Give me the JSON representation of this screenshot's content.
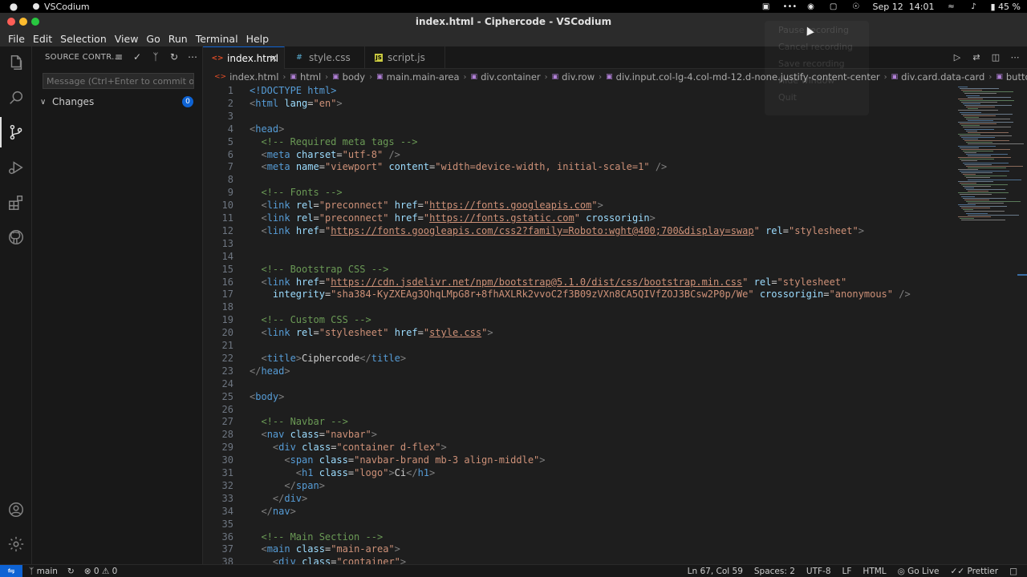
{
  "os": {
    "app_name": "VSCodium",
    "date": "Sep 12",
    "time": "14:01",
    "battery": "45 %"
  },
  "window": {
    "title": "index.html - Ciphercode - VSCodium"
  },
  "menu": [
    "File",
    "Edit",
    "Selection",
    "View",
    "Go",
    "Run",
    "Terminal",
    "Help"
  ],
  "ghost_menu": [
    "Pause recording",
    "Cancel recording",
    "Save recording",
    "Hide window",
    "Quit"
  ],
  "sidebar": {
    "header": "SOURCE CONTR...",
    "commit_placeholder": "Message (Ctrl+Enter to commit on ...",
    "changes_label": "Changes",
    "changes_count": "0"
  },
  "tabs": [
    {
      "label": "index.html",
      "type": "html",
      "icon": "html-file-icon",
      "active": true
    },
    {
      "label": "style.css",
      "type": "css",
      "icon": "css-file-icon",
      "active": false
    },
    {
      "label": "script.js",
      "type": "js",
      "icon": "js-file-icon",
      "active": false
    }
  ],
  "breadcrumb": [
    "index.html",
    "html",
    "body",
    "main.main-area",
    "div.container",
    "div.row",
    "div.input.col-lg-4.col-md-12.d-none.justify-content-center",
    "div.card.data-card",
    "button.btn.btn-md.d-non"
  ],
  "code_lines": [
    [
      [
        "doc",
        "<!DOCTYPE html>"
      ]
    ],
    [
      [
        "br",
        "<"
      ],
      [
        "tag",
        "html"
      ],
      [
        "p",
        " "
      ],
      [
        "attr",
        "lang"
      ],
      [
        "p",
        "="
      ],
      [
        "str",
        "\"en\""
      ],
      [
        "br",
        ">"
      ]
    ],
    [],
    [
      [
        "br",
        "<"
      ],
      [
        "tag",
        "head"
      ],
      [
        "br",
        ">"
      ]
    ],
    [
      [
        "p",
        "  "
      ],
      [
        "com",
        "<!-- Required meta tags -->"
      ]
    ],
    [
      [
        "p",
        "  "
      ],
      [
        "br",
        "<"
      ],
      [
        "tag",
        "meta"
      ],
      [
        "p",
        " "
      ],
      [
        "attr",
        "charset"
      ],
      [
        "p",
        "="
      ],
      [
        "str",
        "\"utf-8\""
      ],
      [
        "p",
        " "
      ],
      [
        "br",
        "/>"
      ]
    ],
    [
      [
        "p",
        "  "
      ],
      [
        "br",
        "<"
      ],
      [
        "tag",
        "meta"
      ],
      [
        "p",
        " "
      ],
      [
        "attr",
        "name"
      ],
      [
        "p",
        "="
      ],
      [
        "str",
        "\"viewport\""
      ],
      [
        "p",
        " "
      ],
      [
        "attr",
        "content"
      ],
      [
        "p",
        "="
      ],
      [
        "str",
        "\"width=device-width, initial-scale=1\""
      ],
      [
        "p",
        " "
      ],
      [
        "br",
        "/>"
      ]
    ],
    [],
    [
      [
        "p",
        "  "
      ],
      [
        "com",
        "<!-- Fonts -->"
      ]
    ],
    [
      [
        "p",
        "  "
      ],
      [
        "br",
        "<"
      ],
      [
        "tag",
        "link"
      ],
      [
        "p",
        " "
      ],
      [
        "attr",
        "rel"
      ],
      [
        "p",
        "="
      ],
      [
        "str",
        "\"preconnect\""
      ],
      [
        "p",
        " "
      ],
      [
        "attr",
        "href"
      ],
      [
        "p",
        "="
      ],
      [
        "str",
        "\""
      ],
      [
        "url",
        "https://fonts.googleapis.com"
      ],
      [
        "str",
        "\""
      ],
      [
        "br",
        ">"
      ]
    ],
    [
      [
        "p",
        "  "
      ],
      [
        "br",
        "<"
      ],
      [
        "tag",
        "link"
      ],
      [
        "p",
        " "
      ],
      [
        "attr",
        "rel"
      ],
      [
        "p",
        "="
      ],
      [
        "str",
        "\"preconnect\""
      ],
      [
        "p",
        " "
      ],
      [
        "attr",
        "href"
      ],
      [
        "p",
        "="
      ],
      [
        "str",
        "\""
      ],
      [
        "url",
        "https://fonts.gstatic.com"
      ],
      [
        "str",
        "\""
      ],
      [
        "p",
        " "
      ],
      [
        "attr",
        "crossorigin"
      ],
      [
        "br",
        ">"
      ]
    ],
    [
      [
        "p",
        "  "
      ],
      [
        "br",
        "<"
      ],
      [
        "tag",
        "link"
      ],
      [
        "p",
        " "
      ],
      [
        "attr",
        "href"
      ],
      [
        "p",
        "="
      ],
      [
        "str",
        "\""
      ],
      [
        "url",
        "https://fonts.googleapis.com/css2?family=Roboto:wght@400;700&display=swap"
      ],
      [
        "str",
        "\""
      ],
      [
        "p",
        " "
      ],
      [
        "attr",
        "rel"
      ],
      [
        "p",
        "="
      ],
      [
        "str",
        "\"stylesheet\""
      ],
      [
        "br",
        ">"
      ]
    ],
    [],
    [],
    [
      [
        "p",
        "  "
      ],
      [
        "com",
        "<!-- Bootstrap CSS -->"
      ]
    ],
    [
      [
        "p",
        "  "
      ],
      [
        "br",
        "<"
      ],
      [
        "tag",
        "link"
      ],
      [
        "p",
        " "
      ],
      [
        "attr",
        "href"
      ],
      [
        "p",
        "="
      ],
      [
        "str",
        "\""
      ],
      [
        "url",
        "https://cdn.jsdelivr.net/npm/bootstrap@5.1.0/dist/css/bootstrap.min.css"
      ],
      [
        "str",
        "\""
      ],
      [
        "p",
        " "
      ],
      [
        "attr",
        "rel"
      ],
      [
        "p",
        "="
      ],
      [
        "str",
        "\"stylesheet\""
      ]
    ],
    [
      [
        "p",
        "    "
      ],
      [
        "attr",
        "integrity"
      ],
      [
        "p",
        "="
      ],
      [
        "str",
        "\"sha384-KyZXEAg3QhqLMpG8r+8fhAXLRk2vvoC2f3B09zVXn8CA5QIVfZOJ3BCsw2P0p/We\""
      ],
      [
        "p",
        " "
      ],
      [
        "attr",
        "crossorigin"
      ],
      [
        "p",
        "="
      ],
      [
        "str",
        "\"anonymous\""
      ],
      [
        "p",
        " "
      ],
      [
        "br",
        "/>"
      ]
    ],
    [],
    [
      [
        "p",
        "  "
      ],
      [
        "com",
        "<!-- Custom CSS -->"
      ]
    ],
    [
      [
        "p",
        "  "
      ],
      [
        "br",
        "<"
      ],
      [
        "tag",
        "link"
      ],
      [
        "p",
        " "
      ],
      [
        "attr",
        "rel"
      ],
      [
        "p",
        "="
      ],
      [
        "str",
        "\"stylesheet\""
      ],
      [
        "p",
        " "
      ],
      [
        "attr",
        "href"
      ],
      [
        "p",
        "="
      ],
      [
        "str",
        "\""
      ],
      [
        "url",
        "style.css"
      ],
      [
        "str",
        "\""
      ],
      [
        "br",
        ">"
      ]
    ],
    [],
    [
      [
        "p",
        "  "
      ],
      [
        "br",
        "<"
      ],
      [
        "tag",
        "title"
      ],
      [
        "br",
        ">"
      ],
      [
        "p",
        "Ciphercode"
      ],
      [
        "br",
        "</"
      ],
      [
        "tag",
        "title"
      ],
      [
        "br",
        ">"
      ]
    ],
    [
      [
        "br",
        "</"
      ],
      [
        "tag",
        "head"
      ],
      [
        "br",
        ">"
      ]
    ],
    [],
    [
      [
        "br",
        "<"
      ],
      [
        "tag",
        "body"
      ],
      [
        "br",
        ">"
      ]
    ],
    [],
    [
      [
        "p",
        "  "
      ],
      [
        "com",
        "<!-- Navbar -->"
      ]
    ],
    [
      [
        "p",
        "  "
      ],
      [
        "br",
        "<"
      ],
      [
        "tag",
        "nav"
      ],
      [
        "p",
        " "
      ],
      [
        "attr",
        "class"
      ],
      [
        "p",
        "="
      ],
      [
        "str",
        "\"navbar\""
      ],
      [
        "br",
        ">"
      ]
    ],
    [
      [
        "p",
        "    "
      ],
      [
        "br",
        "<"
      ],
      [
        "tag",
        "div"
      ],
      [
        "p",
        " "
      ],
      [
        "attr",
        "class"
      ],
      [
        "p",
        "="
      ],
      [
        "str",
        "\"container d-flex\""
      ],
      [
        "br",
        ">"
      ]
    ],
    [
      [
        "p",
        "      "
      ],
      [
        "br",
        "<"
      ],
      [
        "tag",
        "span"
      ],
      [
        "p",
        " "
      ],
      [
        "attr",
        "class"
      ],
      [
        "p",
        "="
      ],
      [
        "str",
        "\"navbar-brand mb-3 align-middle\""
      ],
      [
        "br",
        ">"
      ]
    ],
    [
      [
        "p",
        "        "
      ],
      [
        "br",
        "<"
      ],
      [
        "tag",
        "h1"
      ],
      [
        "p",
        " "
      ],
      [
        "attr",
        "class"
      ],
      [
        "p",
        "="
      ],
      [
        "str",
        "\"logo\""
      ],
      [
        "br",
        ">"
      ],
      [
        "p",
        "Ci"
      ],
      [
        "br",
        "</"
      ],
      [
        "tag",
        "h1"
      ],
      [
        "br",
        ">"
      ]
    ],
    [
      [
        "p",
        "      "
      ],
      [
        "br",
        "</"
      ],
      [
        "tag",
        "span"
      ],
      [
        "br",
        ">"
      ]
    ],
    [
      [
        "p",
        "    "
      ],
      [
        "br",
        "</"
      ],
      [
        "tag",
        "div"
      ],
      [
        "br",
        ">"
      ]
    ],
    [
      [
        "p",
        "  "
      ],
      [
        "br",
        "</"
      ],
      [
        "tag",
        "nav"
      ],
      [
        "br",
        ">"
      ]
    ],
    [],
    [
      [
        "p",
        "  "
      ],
      [
        "com",
        "<!-- Main Section -->"
      ]
    ],
    [
      [
        "p",
        "  "
      ],
      [
        "br",
        "<"
      ],
      [
        "tag",
        "main"
      ],
      [
        "p",
        " "
      ],
      [
        "attr",
        "class"
      ],
      [
        "p",
        "="
      ],
      [
        "str",
        "\"main-area\""
      ],
      [
        "br",
        ">"
      ]
    ],
    [
      [
        "p",
        "    "
      ],
      [
        "br",
        "<"
      ],
      [
        "tag",
        "div"
      ],
      [
        "p",
        " "
      ],
      [
        "attr",
        "class"
      ],
      [
        "p",
        "="
      ],
      [
        "str",
        "\"container\""
      ],
      [
        "br",
        ">"
      ]
    ]
  ],
  "status": {
    "branch": "main",
    "problems": "⊗ 0 ⚠ 0",
    "position": "Ln 67, Col 59",
    "spaces": "Spaces: 2",
    "encoding": "UTF-8",
    "eol": "LF",
    "language": "HTML",
    "live": "Go Live",
    "prettier": "Prettier"
  },
  "colors": {
    "accent": "#0e63d4",
    "tag": "#569cd6",
    "attr": "#9cdcfe",
    "string": "#ce9178",
    "comment": "#6a9955"
  }
}
